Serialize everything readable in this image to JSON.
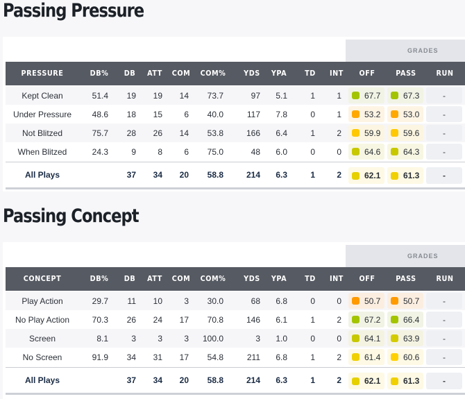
{
  "sections": [
    {
      "title": "Passing Pressure",
      "grades_label": "GRADES",
      "headers": [
        "PRESSURE",
        "DB%",
        "DB",
        "ATT",
        "COM",
        "COM%",
        "YDS",
        "YPA",
        "TD",
        "INT",
        "OFF",
        "PASS",
        "RUN"
      ],
      "rows": [
        {
          "label": "Kept Clean",
          "db_pct": "51.4",
          "db": "19",
          "att": "19",
          "com": "14",
          "com_pct": "73.7",
          "yds": "97",
          "ypa": "5.1",
          "td": "1",
          "int": "1",
          "off": "67.7",
          "off_color": "#a3c400",
          "off_bg": "#f1f4e4",
          "pass": "67.3",
          "pass_color": "#a3c400",
          "pass_bg": "#f1f4e4",
          "run": "-",
          "next_bg": "#fbf8e4"
        },
        {
          "label": "Under Pressure",
          "db_pct": "48.6",
          "db": "18",
          "att": "15",
          "com": "6",
          "com_pct": "40.0",
          "yds": "117",
          "ypa": "7.8",
          "td": "0",
          "int": "1",
          "off": "53.2",
          "off_color": "#ffa800",
          "off_bg": "#fdf4e4",
          "pass": "53.0",
          "pass_color": "#ffa800",
          "pass_bg": "#fdf4e4",
          "run": "-",
          "next_bg": "#fdecea"
        },
        {
          "label": "Not Blitzed",
          "db_pct": "75.7",
          "db": "28",
          "att": "26",
          "com": "14",
          "com_pct": "53.8",
          "yds": "166",
          "ypa": "6.4",
          "td": "1",
          "int": "2",
          "off": "59.9",
          "off_color": "#ffc800",
          "off_bg": "#fcf5e1",
          "pass": "59.6",
          "pass_color": "#ffc800",
          "pass_bg": "#fcf5e1",
          "run": "-",
          "next_bg": "#fdecea"
        },
        {
          "label": "When Blitzed",
          "db_pct": "24.3",
          "db": "9",
          "att": "8",
          "com": "6",
          "com_pct": "75.0",
          "yds": "48",
          "ypa": "6.0",
          "td": "0",
          "int": "0",
          "off": "64.6",
          "off_color": "#c8c800",
          "off_bg": "#f7f6e2",
          "pass": "64.3",
          "pass_color": "#c8c800",
          "pass_bg": "#f7f6e2",
          "run": "-",
          "next_bg": "#fbf8e4"
        }
      ],
      "total": {
        "label": "All Plays",
        "db_pct": "",
        "db": "37",
        "att": "34",
        "com": "20",
        "com_pct": "58.8",
        "yds": "214",
        "ypa": "6.3",
        "td": "1",
        "int": "2",
        "off": "62.1",
        "off_color": "#e6d000",
        "off_bg": "#fdf9e4",
        "pass": "61.3",
        "pass_color": "#f0d000",
        "pass_bg": "#fdf9e4",
        "run": "-",
        "next_bg": "#fdecea"
      }
    },
    {
      "title": "Passing Concept",
      "grades_label": "GRADES",
      "headers": [
        "CONCEPT",
        "DB%",
        "DB",
        "ATT",
        "COM",
        "COM%",
        "YDS",
        "YPA",
        "TD",
        "INT",
        "OFF",
        "PASS",
        "RUN"
      ],
      "rows": [
        {
          "label": "Play Action",
          "db_pct": "29.7",
          "db": "11",
          "att": "10",
          "com": "3",
          "com_pct": "30.0",
          "yds": "68",
          "ypa": "6.8",
          "td": "0",
          "int": "0",
          "off": "50.7",
          "off_color": "#ff9a00",
          "off_bg": "#fbeee0",
          "pass": "50.7",
          "pass_color": "#ff9a00",
          "pass_bg": "#fbeee0",
          "run": "-",
          "next_bg": "#fdecea"
        },
        {
          "label": "No Play Action",
          "db_pct": "70.3",
          "db": "26",
          "att": "24",
          "com": "17",
          "com_pct": "70.8",
          "yds": "146",
          "ypa": "6.1",
          "td": "1",
          "int": "2",
          "off": "67.2",
          "off_color": "#a3c400",
          "off_bg": "#f1f4e4",
          "pass": "66.4",
          "pass_color": "#a3c400",
          "pass_bg": "#f1f4e4",
          "run": "-",
          "next_bg": "#fbf8e4"
        },
        {
          "label": "Screen",
          "db_pct": "8.1",
          "db": "3",
          "att": "3",
          "com": "3",
          "com_pct": "100.0",
          "yds": "3",
          "ypa": "1.0",
          "td": "0",
          "int": "0",
          "off": "64.1",
          "off_color": "#c8c800",
          "off_bg": "#f4f3e2",
          "pass": "63.9",
          "pass_color": "#d4cc00",
          "pass_bg": "#f4f3e2",
          "run": "-",
          "next_bg": "#fbf8e4"
        },
        {
          "label": "No Screen",
          "db_pct": "91.9",
          "db": "34",
          "att": "31",
          "com": "17",
          "com_pct": "54.8",
          "yds": "211",
          "ypa": "6.8",
          "td": "1",
          "int": "2",
          "off": "61.4",
          "off_color": "#f0d000",
          "off_bg": "#fdf9e4",
          "pass": "60.6",
          "pass_color": "#ffd000",
          "pass_bg": "#fdf9e4",
          "run": "-",
          "next_bg": "#fdecea"
        }
      ],
      "total": {
        "label": "All Plays",
        "db_pct": "",
        "db": "37",
        "att": "34",
        "com": "20",
        "com_pct": "58.8",
        "yds": "214",
        "ypa": "6.3",
        "td": "1",
        "int": "2",
        "off": "62.1",
        "off_color": "#e6d000",
        "off_bg": "#fdf9e4",
        "pass": "61.3",
        "pass_color": "#f0d000",
        "pass_bg": "#fdf9e4",
        "run": "-",
        "next_bg": "#fdecea"
      }
    }
  ]
}
